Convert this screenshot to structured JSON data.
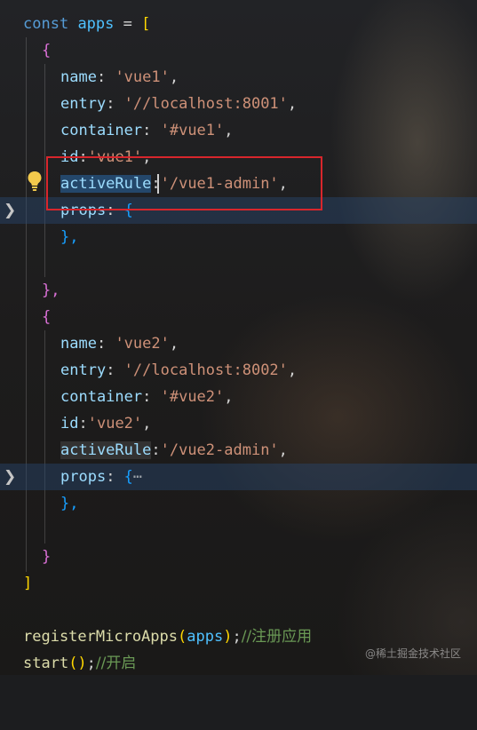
{
  "editor": {
    "line1": {
      "kw": "const",
      "var": "apps",
      "op": " = ",
      "open": "["
    },
    "obj1": {
      "open": "{",
      "name_key": "name",
      "name_val": "'vue1'",
      "entry_key": "entry",
      "entry_val": "'//localhost:8001'",
      "container_key": "container",
      "container_val": "'#vue1'",
      "id_key": "id",
      "id_val": "'vue1'",
      "activeRule_key": "activeRule",
      "activeRule_val": "'/vue1-admin'",
      "props_key": "props",
      "props_open": "{",
      "props_close": "},",
      "close": "},"
    },
    "obj2": {
      "open": "{",
      "name_key": "name",
      "name_val": "'vue2'",
      "entry_key": "entry",
      "entry_val": "'//localhost:8002'",
      "container_key": "container",
      "container_val": "'#vue2'",
      "id_key": "id",
      "id_val": "'vue2'",
      "activeRule_key": "activeRule",
      "activeRule_val": "'/vue2-admin'",
      "props_key": "props",
      "props_open": "{",
      "props_collapsed": "⋯",
      "props_close": "},",
      "close": "}"
    },
    "array_close": "]",
    "call1": {
      "fn": "registerMicroApps",
      "arg": "apps",
      "comment": "//注册应用"
    },
    "call2": {
      "fn": "start",
      "comment": "//开启"
    },
    "fold_icon": "chevron-right-icon",
    "lightbulb_icon": "lightbulb-icon"
  },
  "watermark": "@稀土掘金技术社区",
  "colors": {
    "highlight": "#28466e",
    "annotation": "#d8262c",
    "bulb": "#f2c94c"
  }
}
